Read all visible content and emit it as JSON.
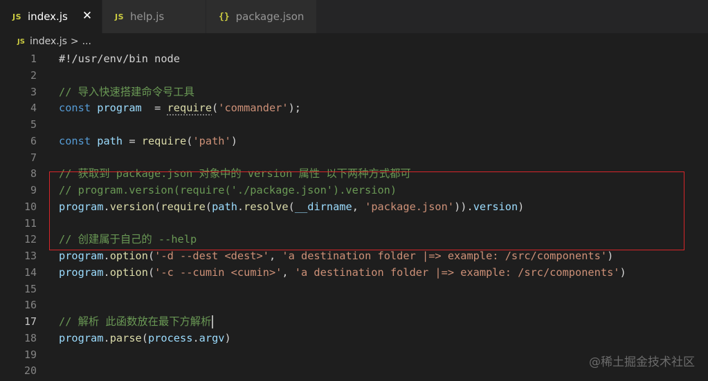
{
  "tabs": [
    {
      "icon": "JS",
      "label": "index.js",
      "active": true,
      "close": "✕"
    },
    {
      "icon": "JS",
      "label": "help.js",
      "active": false
    },
    {
      "icon": "{}",
      "label": "package.json",
      "active": false
    }
  ],
  "breadcrumb": {
    "icon": "JS",
    "file": "index.js",
    "separator": ">",
    "more": "..."
  },
  "lines": [
    {
      "n": "1",
      "tokens": [
        [
          "c",
          "#!/usr/env/bin node"
        ]
      ]
    },
    {
      "n": "2",
      "tokens": []
    },
    {
      "n": "3",
      "tokens": [
        [
          "cm",
          "// 导入快速搭建命令号工具"
        ]
      ]
    },
    {
      "n": "4",
      "tokens": [
        [
          "kw",
          "const "
        ],
        [
          "var",
          "program"
        ],
        [
          "c",
          "  = "
        ],
        [
          "fnsq",
          "require"
        ],
        [
          "c",
          "("
        ],
        [
          "str",
          "'commander'"
        ],
        [
          "c",
          ");"
        ]
      ]
    },
    {
      "n": "5",
      "tokens": []
    },
    {
      "n": "6",
      "tokens": [
        [
          "kw",
          "const "
        ],
        [
          "var",
          "path"
        ],
        [
          "c",
          " = "
        ],
        [
          "fn",
          "require"
        ],
        [
          "c",
          "("
        ],
        [
          "str",
          "'path'"
        ],
        [
          "c",
          ")"
        ]
      ]
    },
    {
      "n": "7",
      "tokens": []
    },
    {
      "n": "8",
      "tokens": [
        [
          "cm",
          "// 获取到 package.json 对象中的 version 属性 以下两种方式都可"
        ]
      ]
    },
    {
      "n": "9",
      "tokens": [
        [
          "cm",
          "// program.version(require('./package.json').version)"
        ]
      ]
    },
    {
      "n": "10",
      "tokens": [
        [
          "var",
          "program"
        ],
        [
          "c",
          "."
        ],
        [
          "fn",
          "version"
        ],
        [
          "c",
          "("
        ],
        [
          "fn",
          "require"
        ],
        [
          "c",
          "("
        ],
        [
          "var",
          "path"
        ],
        [
          "c",
          "."
        ],
        [
          "fn",
          "resolve"
        ],
        [
          "c",
          "("
        ],
        [
          "var",
          "__dirname"
        ],
        [
          "c",
          ", "
        ],
        [
          "str",
          "'package.json'"
        ],
        [
          "c",
          "))."
        ],
        [
          "var",
          "version"
        ],
        [
          "c",
          ")"
        ]
      ]
    },
    {
      "n": "11",
      "tokens": []
    },
    {
      "n": "12",
      "tokens": [
        [
          "cm",
          "// 创建属于自己的 --help"
        ]
      ]
    },
    {
      "n": "13",
      "tokens": [
        [
          "var",
          "program"
        ],
        [
          "c",
          "."
        ],
        [
          "fn",
          "option"
        ],
        [
          "c",
          "("
        ],
        [
          "str",
          "'-d --dest <dest>'"
        ],
        [
          "c",
          ", "
        ],
        [
          "str",
          "'a destination folder |=> example: /src/components'"
        ],
        [
          "c",
          ")"
        ]
      ]
    },
    {
      "n": "14",
      "tokens": [
        [
          "var",
          "program"
        ],
        [
          "c",
          "."
        ],
        [
          "fn",
          "option"
        ],
        [
          "c",
          "("
        ],
        [
          "str",
          "'-c --cumin <cumin>'"
        ],
        [
          "c",
          ", "
        ],
        [
          "str",
          "'a destination folder |=> example: /src/components'"
        ],
        [
          "c",
          ")"
        ]
      ]
    },
    {
      "n": "15",
      "tokens": []
    },
    {
      "n": "16",
      "tokens": []
    },
    {
      "n": "17",
      "current": true,
      "cursor": true,
      "tokens": [
        [
          "cm",
          "// 解析 此函数放在最下方解析"
        ]
      ]
    },
    {
      "n": "18",
      "tokens": [
        [
          "var",
          "program"
        ],
        [
          "c",
          "."
        ],
        [
          "fn",
          "parse"
        ],
        [
          "c",
          "("
        ],
        [
          "var",
          "process"
        ],
        [
          "c",
          "."
        ],
        [
          "var",
          "argv"
        ],
        [
          "c",
          ")"
        ]
      ]
    },
    {
      "n": "19",
      "tokens": []
    },
    {
      "n": "20",
      "tokens": []
    }
  ],
  "watermark": "@稀土掘金技术社区",
  "colors": {
    "background": "#1e1e1e",
    "comment": "#6a9955",
    "keyword": "#569cd6",
    "variable": "#9cdcfe",
    "function": "#dcdcaa",
    "string": "#ce9178",
    "highlight_box": "#d9262a"
  }
}
